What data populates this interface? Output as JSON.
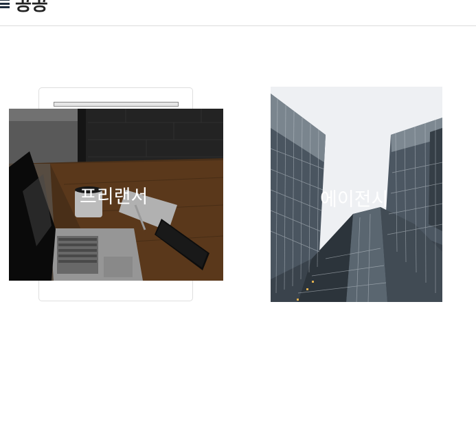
{
  "header": {
    "title": "공공"
  },
  "tiles": {
    "freelancer": {
      "label": "프리랜서"
    },
    "agency": {
      "label": "에이전시"
    }
  }
}
